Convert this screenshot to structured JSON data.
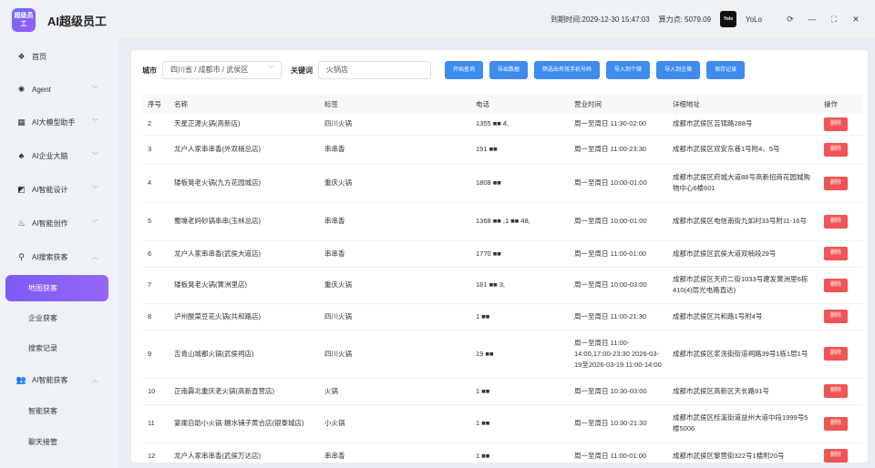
{
  "app": {
    "logo_text": "超级员工",
    "title": "AI超级员工"
  },
  "header": {
    "expire_label": "到期时间:",
    "expire_value": "2029-12-30 15:47:03",
    "points_label": "算力点:",
    "points_value": "5079.09",
    "avatar_text": "Yolo",
    "username": "YoLo"
  },
  "sidebar": {
    "items": [
      {
        "label": "首页",
        "icon": "home-icon"
      },
      {
        "label": "Agent",
        "icon": "agent-icon"
      },
      {
        "label": "AI大模型助手",
        "icon": "grid-icon"
      },
      {
        "label": "AI企业大脑",
        "icon": "brain-icon"
      },
      {
        "label": "AI智能设计",
        "icon": "design-icon"
      },
      {
        "label": "AI智能创作",
        "icon": "flame-icon"
      },
      {
        "label": "AI搜索获客",
        "icon": "location-icon"
      },
      {
        "label": "AI智能获客",
        "icon": "users-icon"
      }
    ],
    "search_sub": [
      "地图获客",
      "企业获客",
      "搜索记录"
    ],
    "smart_sub": [
      "智能获客",
      "聊天接管"
    ]
  },
  "filters": {
    "city_label": "城市",
    "city_value": "四川省 / 成都市 / 武侯区",
    "keyword_label": "关键词",
    "keyword_value": "火锅店",
    "buttons": [
      "开始查询",
      "导出数据",
      "筛选出有效手机号码",
      "导入到个微",
      "导入到企微",
      "保存记录"
    ]
  },
  "table": {
    "headers": [
      "序号",
      "名称",
      "标签",
      "电话",
      "营业时间",
      "详细地址",
      "操作"
    ],
    "delete_label": "删除",
    "rows": [
      {
        "no": "2",
        "name": "天星正源火锅(高新店)",
        "tag": "四川火锅",
        "phone": "1355 ■■ 4,",
        "hours": "周一至周日 11:30-02:00",
        "addr": "成都市武侯区芸锦路288号"
      },
      {
        "no": "3",
        "name": "龙户人家串串香(外双楠总店)",
        "tag": "串串香",
        "phone": "191 ■■",
        "hours": "周一至周日 11:00-23:30",
        "addr": "成都市武侯区双安东巷1号附4、5号"
      },
      {
        "no": "4",
        "name": "矮板凳老火锅(九方花园城店)",
        "tag": "重庆火锅",
        "phone": "1808 ■■",
        "hours": "周一至周日 10:00-01:00",
        "addr": "成都市武侯区府城大道88号高新招商花园城购物中心6楼601"
      },
      {
        "no": "5",
        "name": "蜀壕老妈砂锅串串(玉林总店)",
        "tag": "串串香",
        "phone": "1368 ■■ ,1 ■■ 48,",
        "hours": "周一至周日 10:00-01:00",
        "addr": "成都市武侯区电信南街九如村33号附11-16号"
      },
      {
        "no": "6",
        "name": "龙户人家串串香(武侯大道店)",
        "tag": "串串香",
        "phone": "1770 ■■",
        "hours": "周一至周日 11:00-01:00",
        "addr": "成都市武侯区武侯大道双楠段29号"
      },
      {
        "no": "7",
        "name": "矮板凳老火锅(簧洲里店)",
        "tag": "重庆火锅",
        "phone": "181 ■■ 3,",
        "hours": "周一至周日 10:00-03:00",
        "addr": "成都市武侯区天府二街1033号建发簧洲里6栋410(4)层光电路直达)"
      },
      {
        "no": "8",
        "name": "泸州酸菜豆花火锅(共和路店)",
        "tag": "四川火锅",
        "phone": "1 ■■",
        "hours": "周一至周日 11:00-21:30",
        "addr": "成都市武侯区共和路1号附4号"
      },
      {
        "no": "9",
        "name": "吉青山城都火锅(武侯祠店)",
        "tag": "四川火锅",
        "phone": "19 ■■",
        "hours": "周一至周日 11:00-14:00,17:00-23:30 2026-03-19至2026-03-19 11:00-14:00",
        "addr": "成都市武侯区浆洗街街道祠路39号1栋1层1号"
      },
      {
        "no": "10",
        "name": "正南霹北重庆老火锅(高新直营店)",
        "tag": "火锅",
        "phone": "1 ■■",
        "hours": "周一至周日 10:30-03:00",
        "addr": "成都市武侯区高新区天长路91号"
      },
      {
        "no": "11",
        "name": "宴阑自助小火锅·糖水铺子黄合店(银泰城店)",
        "tag": "小火锅",
        "phone": "1 ■■",
        "hours": "周一至周日 10:30-21:30",
        "addr": "成都市武侯区桂溪街道益州大道中段1999号5楼5006"
      },
      {
        "no": "12",
        "name": "龙户人家串串香(武侯万达店)",
        "tag": "串串香",
        "phone": "1 ■■",
        "hours": "周一至周日 11:00-01:00",
        "addr": "成都市武侯区黎营街322号1楼附20号"
      }
    ]
  }
}
